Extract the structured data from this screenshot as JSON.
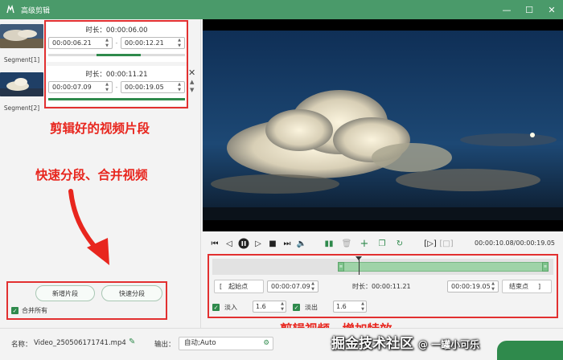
{
  "window": {
    "title": "高级剪辑"
  },
  "segments": [
    {
      "caption": "Segment[1]",
      "duration": "时长：00:00:06.00",
      "start": "00:00:06.21",
      "end": "00:00:12.21",
      "progress": 0.55
    },
    {
      "caption": "Segment[2]",
      "duration": "时长：00:00:11.21",
      "start": "00:00:07.09",
      "end": "00:00:19.05",
      "progress": 1.0
    }
  ],
  "annotations": {
    "segments_note": "剪辑好的视频片段",
    "split_note": "快速分段、合并视频",
    "effects_note": "剪辑视频，增加特效"
  },
  "left_buttons": {
    "new_segment": "新增片段",
    "quick_split": "快速分段",
    "merge_all": "合并所有"
  },
  "player": {
    "timecode": "00:00:10.08/00:00:19.05"
  },
  "trim": {
    "start_label": "起始点",
    "start_value": "00:00:07.09",
    "duration": "时长：00:00:11.21",
    "end_value": "00:00:19.05",
    "end_label": "结束点",
    "playhead_fraction": 0.43,
    "selection_start_fraction": 0.37
  },
  "fade": {
    "fade_in_label": "淡入",
    "fade_in_value": "1.6",
    "fade_out_label": "淡出",
    "fade_out_value": "1.6"
  },
  "bottom": {
    "name_label": "名称：",
    "file_name": "Video_250506171741.mp4",
    "output_label": "输出：",
    "output_value": "自动;Auto"
  },
  "watermark": {
    "text": "掘金技术社区",
    "handle": "@ 一罐小可乐"
  },
  "colors": {
    "titlebar": "#4a9a6a",
    "accent": "#2f8a4c",
    "annotation": "#e8261e",
    "selection": "#9fd3a8"
  }
}
